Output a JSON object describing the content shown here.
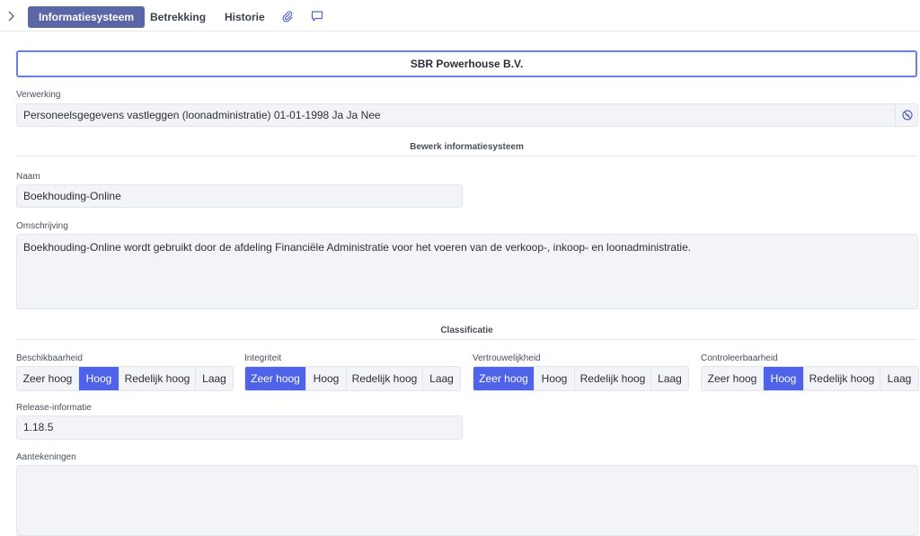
{
  "tabs": {
    "active": "Informatiesysteem",
    "betrekking": "Betrekking",
    "historie": "Historie"
  },
  "icons": {
    "nav": "chevron-right-icon",
    "attachment": "paperclip-icon",
    "comment": "comment-icon",
    "clear": "link-off-icon"
  },
  "org": {
    "name": "SBR Powerhouse B.V."
  },
  "verwerking": {
    "label": "Verwerking",
    "value": "Personeelsgegevens vastleggen (loonadministratie) 01-01-1998 Ja Ja Nee"
  },
  "sections": {
    "edit": "Bewerk informatiesysteem",
    "classification": "Classificatie"
  },
  "naam": {
    "label": "Naam",
    "value": "Boekhouding-Online"
  },
  "omschrijving": {
    "label": "Omschrijving",
    "value": "Boekhouding-Online wordt gebruikt door de afdeling Financiële Administratie voor het voeren van de verkoop-, inkoop- en loonadministratie."
  },
  "classification": {
    "options": [
      "Zeer hoog",
      "Hoog",
      "Redelijk hoog",
      "Laag"
    ],
    "groups": [
      {
        "label": "Beschikbaarheid",
        "selected": "Hoog"
      },
      {
        "label": "Integriteit",
        "selected": "Zeer hoog"
      },
      {
        "label": "Vertrouwelijkheid",
        "selected": "Zeer hoog"
      },
      {
        "label": "Controleerbaarheid",
        "selected": "Hoog"
      }
    ]
  },
  "release": {
    "label": "Release-informatie",
    "value": "1.18.5"
  },
  "aantekeningen": {
    "label": "Aantekeningen",
    "value": ""
  },
  "colors": {
    "accent": "#4f63e8",
    "tab_active": "#5a66a6",
    "focus_border": "#6a7ee8"
  }
}
